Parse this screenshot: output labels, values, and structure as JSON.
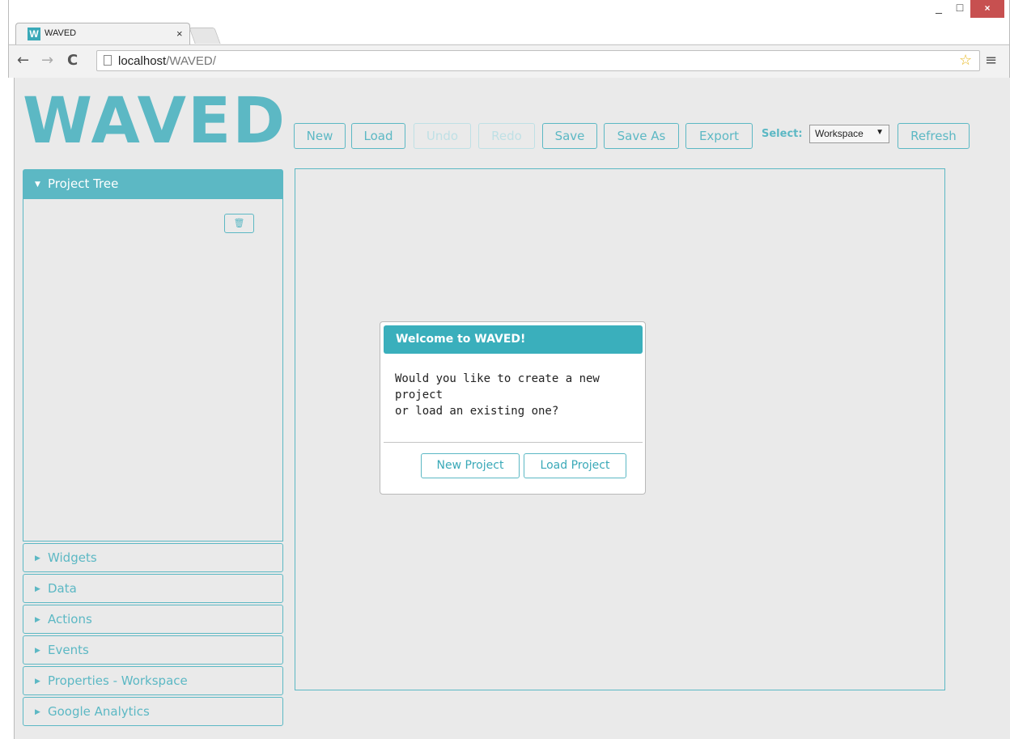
{
  "browser": {
    "tab_title": "WAVED",
    "tab_close": "×",
    "favicon": "W",
    "url_host": "localhost",
    "url_path": "/WAVED/",
    "window_buttons": [
      "_",
      "□",
      "×"
    ]
  },
  "app": {
    "logo": "WAVED",
    "toolbar": {
      "new": "New",
      "load": "Load",
      "undo": "Undo",
      "redo": "Redo",
      "save": "Save",
      "save_as": "Save As",
      "export": "Export",
      "select_label": "Select:",
      "select_value": "Workspace",
      "refresh": "Refresh"
    },
    "sidebar": {
      "expanded": {
        "label": "Project Tree"
      },
      "collapsed": [
        {
          "label": "Widgets"
        },
        {
          "label": "Data"
        },
        {
          "label": "Actions"
        },
        {
          "label": "Events"
        },
        {
          "label": "Properties - Workspace"
        },
        {
          "label": "Google Analytics"
        }
      ]
    },
    "dialog": {
      "title": "Welcome to WAVED!",
      "body_line1": "Would you like to create a new project",
      "body_line2": "or load an existing one?",
      "new_project": "New Project",
      "load_project": "Load Project"
    }
  },
  "colors": {
    "accent": "#5cb8c4",
    "dialog_header": "#3aafbc",
    "disabled": "#bfe0e5"
  }
}
